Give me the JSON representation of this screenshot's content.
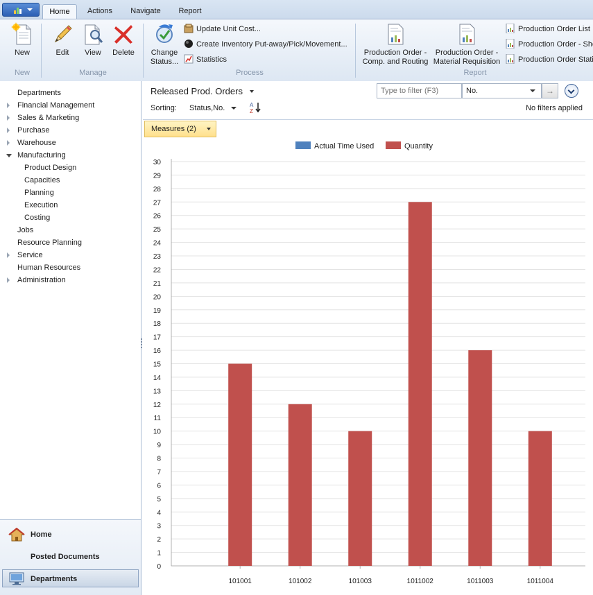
{
  "ribbon": {
    "tabs": [
      {
        "label": "Home",
        "active": true
      },
      {
        "label": "Actions",
        "active": false
      },
      {
        "label": "Navigate",
        "active": false
      },
      {
        "label": "Report",
        "active": false
      }
    ],
    "groups": {
      "new": {
        "label": "New",
        "buttons": [
          "New"
        ]
      },
      "manage": {
        "label": "Manage",
        "buttons": [
          "Edit",
          "View",
          "Delete"
        ]
      },
      "process": {
        "label": "Process",
        "change_status": [
          "Change",
          "Status..."
        ],
        "update_unit_cost": "Update Unit Cost...",
        "create_inventory": "Create Inventory Put-away/Pick/Movement...",
        "statistics": "Statistics"
      },
      "report": {
        "label": "Report",
        "comp_routing": [
          "Production Order -",
          "Comp. and Routing"
        ],
        "material_requisition": [
          "Production Order -",
          "Material Requisition"
        ],
        "order_list": "Production Order List",
        "order_shortage": "Production Order - Sho",
        "order_statistics": "Production Order Stati"
      }
    }
  },
  "nav": {
    "items": [
      {
        "label": "Departments",
        "indent": 0,
        "arrow": "none"
      },
      {
        "label": "Financial Management",
        "indent": 0,
        "arrow": "right"
      },
      {
        "label": "Sales & Marketing",
        "indent": 0,
        "arrow": "right"
      },
      {
        "label": "Purchase",
        "indent": 0,
        "arrow": "right"
      },
      {
        "label": "Warehouse",
        "indent": 0,
        "arrow": "right"
      },
      {
        "label": "Manufacturing",
        "indent": 0,
        "arrow": "down"
      },
      {
        "label": "Product Design",
        "indent": 1,
        "arrow": "none"
      },
      {
        "label": "Capacities",
        "indent": 1,
        "arrow": "none"
      },
      {
        "label": "Planning",
        "indent": 1,
        "arrow": "none"
      },
      {
        "label": "Execution",
        "indent": 1,
        "arrow": "none"
      },
      {
        "label": "Costing",
        "indent": 1,
        "arrow": "none"
      },
      {
        "label": "Jobs",
        "indent": 0,
        "arrow": "none"
      },
      {
        "label": "Resource Planning",
        "indent": 0,
        "arrow": "none"
      },
      {
        "label": "Service",
        "indent": 0,
        "arrow": "right"
      },
      {
        "label": "Human Resources",
        "indent": 0,
        "arrow": "none"
      },
      {
        "label": "Administration",
        "indent": 0,
        "arrow": "right"
      }
    ],
    "bottom": {
      "home": "Home",
      "posted_documents": "Posted Documents",
      "departments": "Departments"
    }
  },
  "content": {
    "title": "Released Prod. Orders",
    "filter": {
      "placeholder": "Type to filter (F3)",
      "field": "No.",
      "go_icon": "arrow-right-icon"
    },
    "sorting": {
      "label": "Sorting:",
      "value": "Status,No."
    },
    "filters_status": "No filters applied",
    "measures_button": "Measures (2)"
  },
  "colors": {
    "actual_time_used": "#4f81bd",
    "quantity": "#c0504d"
  },
  "chart_data": {
    "type": "bar",
    "categories": [
      "101001",
      "101002",
      "101003",
      "1011002",
      "1011003",
      "1011004"
    ],
    "series": [
      {
        "name": "Actual Time Used",
        "values": [
          0,
          0,
          0,
          0,
          0,
          0
        ]
      },
      {
        "name": "Quantity",
        "values": [
          15,
          12,
          10,
          27,
          16,
          10
        ]
      }
    ],
    "ylim": [
      0,
      30
    ],
    "yticks": [
      0,
      1,
      2,
      3,
      4,
      5,
      6,
      7,
      8,
      9,
      10,
      11,
      12,
      13,
      14,
      15,
      16,
      17,
      18,
      19,
      20,
      21,
      22,
      23,
      24,
      25,
      26,
      27,
      28,
      29,
      30
    ],
    "grid": true,
    "legend": "top-center"
  }
}
